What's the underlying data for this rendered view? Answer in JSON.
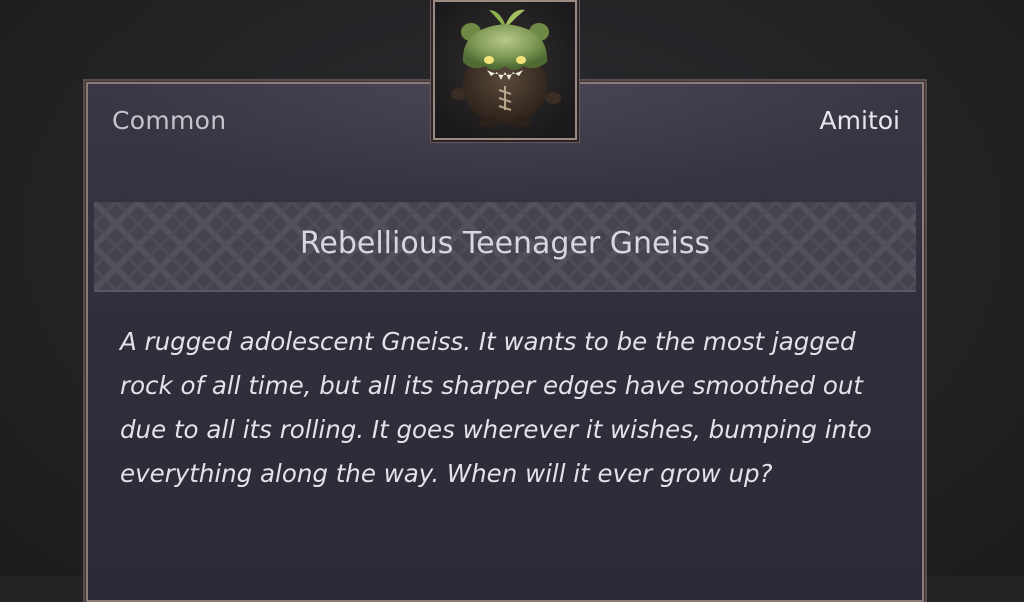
{
  "card": {
    "rarity": "Common",
    "category": "Amitoi",
    "item_name": "Rebellious Teenager Gneiss",
    "description": "A rugged adolescent Gneiss. It wants to be the most jagged rock of all time, but all its sharper edges have smoothed out due to all its rolling. It goes wherever it wishes, bumping into everything along the way. When will it ever grow up?",
    "portrait_icon": "amitoi-gneiss-portrait"
  },
  "colors": {
    "background": "#232325",
    "card_background": "#312f3c",
    "card_border": "#8a7b74",
    "name_band": "#46434f",
    "text_primary": "#e4e2e8",
    "text_secondary": "#c6c3cc"
  }
}
